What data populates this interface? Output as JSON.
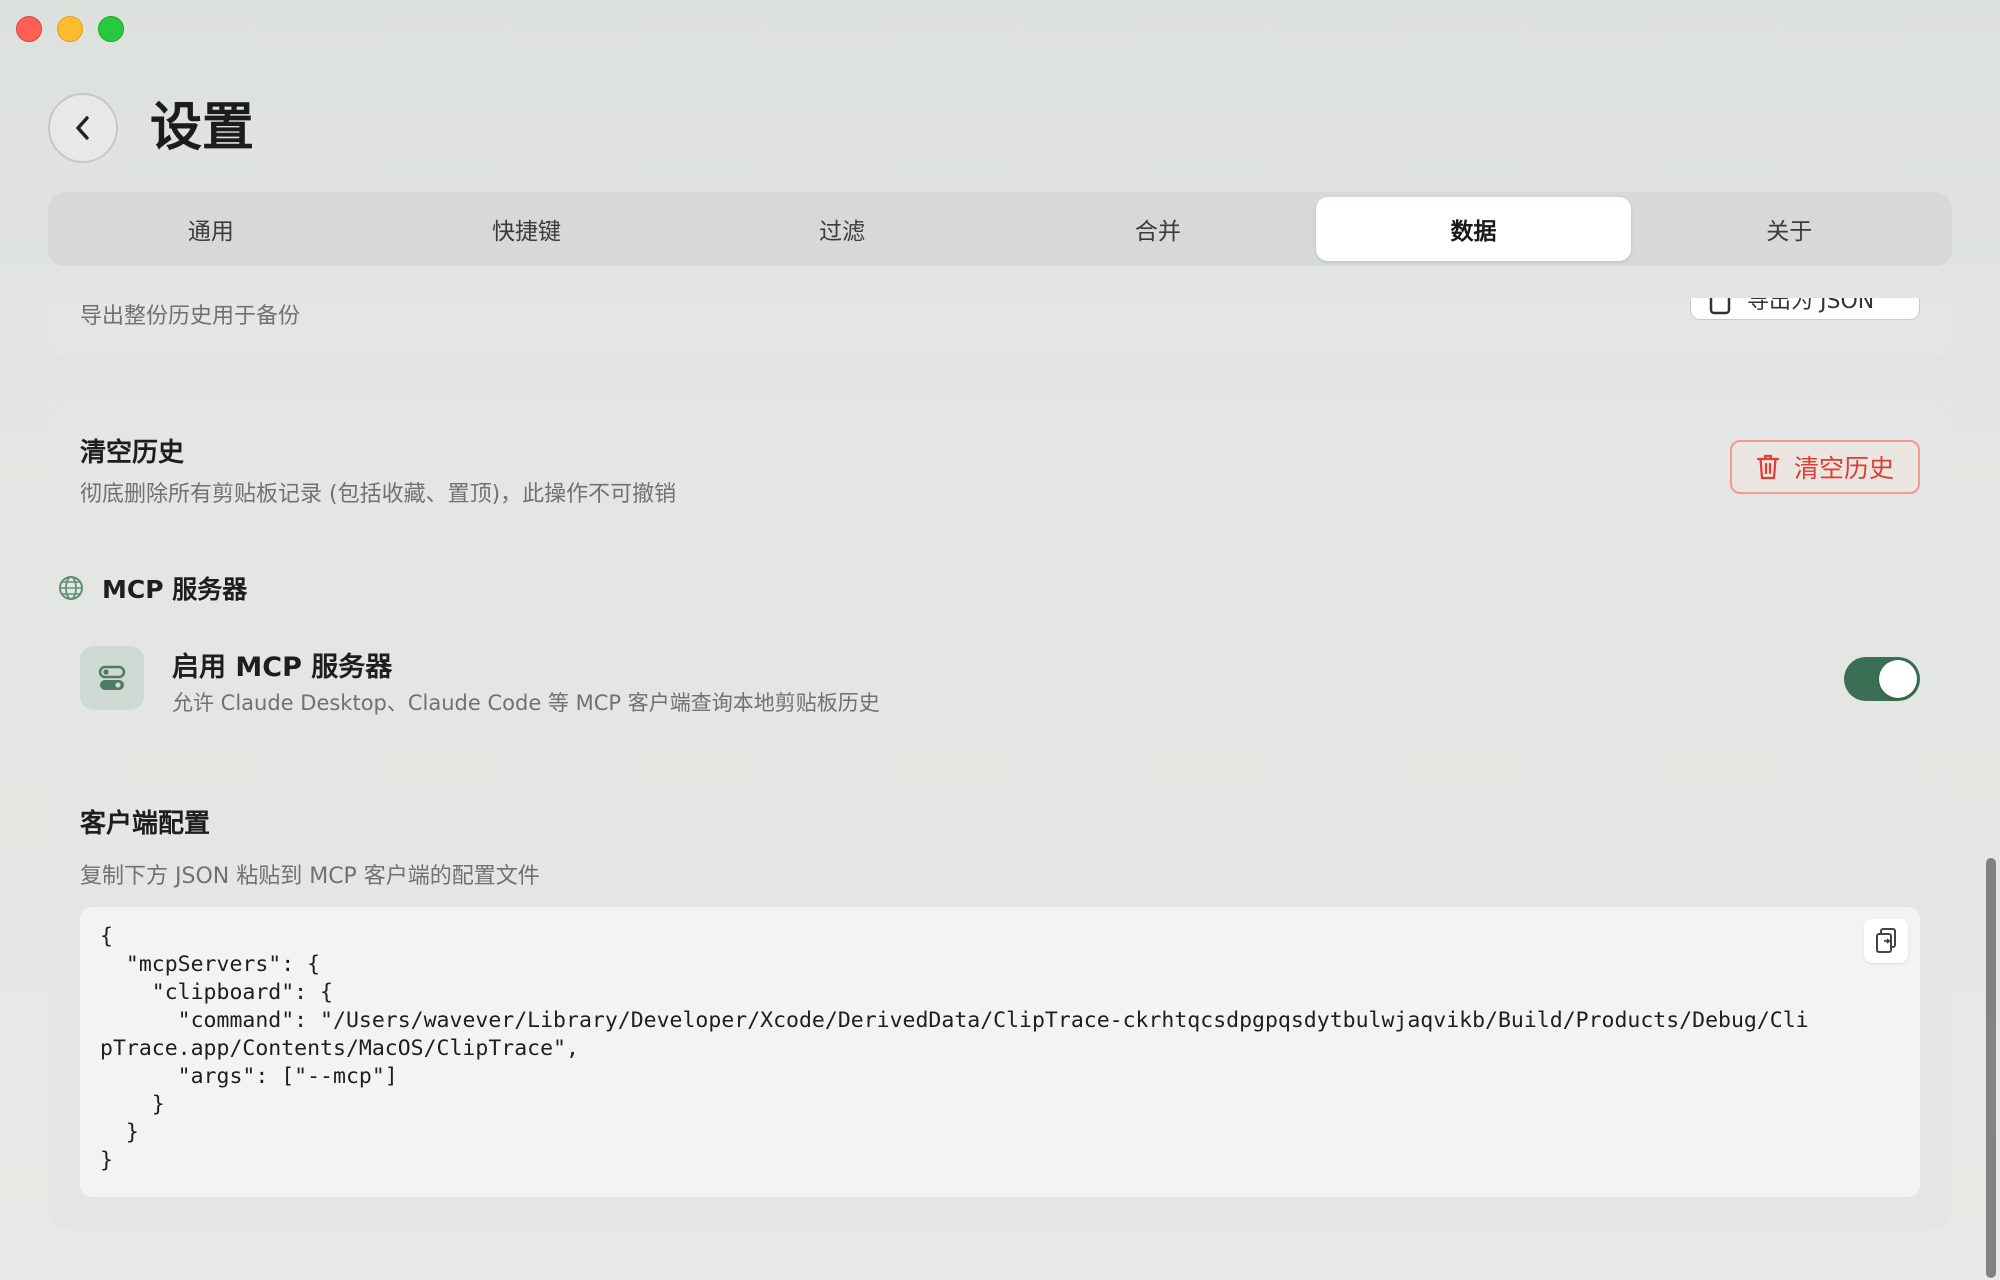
{
  "window": {
    "controls": [
      "close",
      "minimize",
      "maximize"
    ]
  },
  "header": {
    "title": "设置",
    "back_icon": "chevron-left-icon"
  },
  "tabs": [
    {
      "label": "通用",
      "active": false
    },
    {
      "label": "快捷键",
      "active": false
    },
    {
      "label": "过滤",
      "active": false
    },
    {
      "label": "合并",
      "active": false
    },
    {
      "label": "数据",
      "active": true
    },
    {
      "label": "关于",
      "active": false
    }
  ],
  "export": {
    "description": "导出整份历史用于备份",
    "button_label": "导出为 JSON"
  },
  "clear_history": {
    "title": "清空历史",
    "description": "彻底删除所有剪贴板记录 (包括收藏、置顶)，此操作不可撤销",
    "button_label": "清空历史",
    "button_icon": "trash-icon",
    "color": "#e53a2f"
  },
  "mcp_section": {
    "title": "MCP 服务器",
    "icon": "globe-icon"
  },
  "mcp_enable": {
    "title": "启用 MCP 服务器",
    "description": "允许 Claude Desktop、Claude Code 等 MCP 客户端查询本地剪贴板历史",
    "enabled": true,
    "toggle_color": "#3b6f55"
  },
  "client_config": {
    "title": "客户端配置",
    "description": "复制下方 JSON 粘贴到 MCP 客户端的配置文件",
    "code": "{\n  \"mcpServers\": {\n    \"clipboard\": {\n      \"command\": \"/Users/wavever/Library/Developer/Xcode/DerivedData/ClipTrace-ckrhtqcsdpgpqsdytbulwjaqvikb/Build/Products/Debug/ClipTrace.app/Contents/MacOS/ClipTrace\",\n      \"args\": [\"--mcp\"]\n    }\n  }\n}",
    "copy_icon": "copy-icon"
  }
}
